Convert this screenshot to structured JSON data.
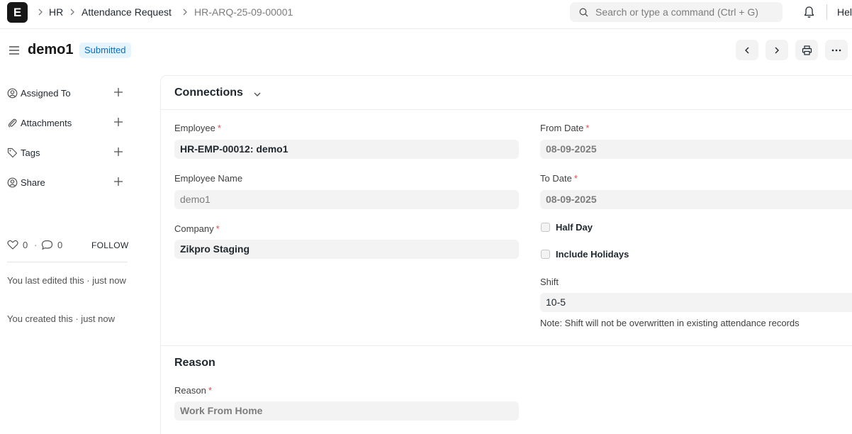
{
  "navbar": {
    "logo_letter": "E",
    "breadcrumbs": [
      "HR",
      "Attendance Request",
      "HR-ARQ-25-09-00001"
    ],
    "search_placeholder": "Search or type a command (Ctrl + G)",
    "user_label": "Hel"
  },
  "page": {
    "title": "demo1",
    "status": "Submitted"
  },
  "sidebar": {
    "items": [
      {
        "label": "Assigned To",
        "icon": "assign-user-icon"
      },
      {
        "label": "Attachments",
        "icon": "paperclip-icon"
      },
      {
        "label": "Tags",
        "icon": "tag-icon"
      },
      {
        "label": "Share",
        "icon": "share-user-icon"
      }
    ],
    "likes": "0",
    "dot": "·",
    "comments": "0",
    "follow_label": "FOLLOW",
    "activity": [
      "You last edited this · just now",
      "You created this · just now"
    ]
  },
  "form": {
    "connections_title": "Connections",
    "employee": {
      "label": "Employee",
      "value": "HR-EMP-00012: demo1"
    },
    "employee_name": {
      "label": "Employee Name",
      "value": "demo1"
    },
    "company": {
      "label": "Company",
      "value": "Zikpro Staging"
    },
    "from_date": {
      "label": "From Date",
      "value": "08-09-2025"
    },
    "to_date": {
      "label": "To Date",
      "value": "08-09-2025"
    },
    "half_day": {
      "label": "Half Day",
      "checked": false
    },
    "include_holidays": {
      "label": "Include Holidays",
      "checked": false
    },
    "shift": {
      "label": "Shift",
      "value": "10-5",
      "note": "Note: Shift will not be overwritten in existing attendance records"
    },
    "reason_section_title": "Reason",
    "reason": {
      "label": "Reason",
      "value": "Work From Home"
    },
    "required_mark": "*"
  },
  "colors": {
    "status_bg": "#e6f4ff",
    "status_text": "#0070cc",
    "required": "#e24c4c"
  }
}
